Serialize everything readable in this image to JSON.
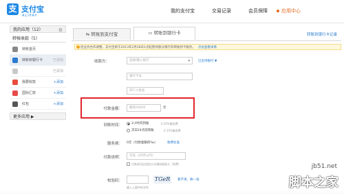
{
  "brand": {
    "mark": "支",
    "name": "支付宝",
    "sub": "ALIPAY"
  },
  "topnav": [
    "我的支付宝",
    "交易记录",
    "会员保障",
    "应用中心"
  ],
  "sidebar": {
    "my_apps": "我的应用（12）",
    "transfer_group": "转帐收款（5）",
    "items": [
      {
        "label": "转账首页",
        "add": ""
      },
      {
        "label": "转账到银行卡",
        "add": "已添加"
      },
      {
        "label": "",
        "add": "已添加"
      },
      {
        "label": "我要收款",
        "add": "+添加"
      },
      {
        "label": "国际汇款",
        "add": "+添加"
      },
      {
        "label": "红包",
        "add": "+添加"
      }
    ],
    "more": "更多应用 ▶"
  },
  "tabs": {
    "tab1": "转账到支付宝",
    "tab2": "转账到银行卡",
    "record_link": "转账到银行卡记录"
  },
  "notice": {
    "text": "因业务合作调整，支付宝将于2013年2月28日1点起暂停部分银行的转账到卡服务。",
    "link": "点此查看详情"
  },
  "form": {
    "payee_label": "收款方：",
    "bank_placeholder": "选择/输入银行",
    "supported_banks": "已支持银行 ▼",
    "card_placeholder": "银行卡号",
    "name_placeholder": "开户人姓名",
    "amount_label": "付款金额：",
    "amount_placeholder": "最高50000",
    "amount_unit": "元",
    "arrival_label": "到账时间：",
    "arrival_opt1": "2小时内到账",
    "arrival_opt1_fee": "0.20%服务费",
    "arrival_opt2": "次日24点前到账",
    "arrival_opt2_fee": "0.15%服务费",
    "fee_label": "服务费：",
    "fee_value": "0元（付款金额的‰）",
    "fee_link": "收费标准",
    "memo_label": "付款说明：",
    "memo_placeholder": "可选（20字以内）",
    "sms_text": "付款成功后短信方式通知收款方（免费）",
    "captcha_label": "校验码：",
    "captcha_hint": "输入上图中的字符",
    "captcha_image_text": "TGeR",
    "captcha_refresh": "看不清，换一张"
  },
  "watermark": {
    "line1": "jb51.net",
    "line2": "脚本之家"
  },
  "colors": {
    "brand_blue": "#1e88e5",
    "accent_orange": "#e46a21",
    "highlight_red": "#e0262b",
    "link_blue": "#2a7ccf"
  }
}
